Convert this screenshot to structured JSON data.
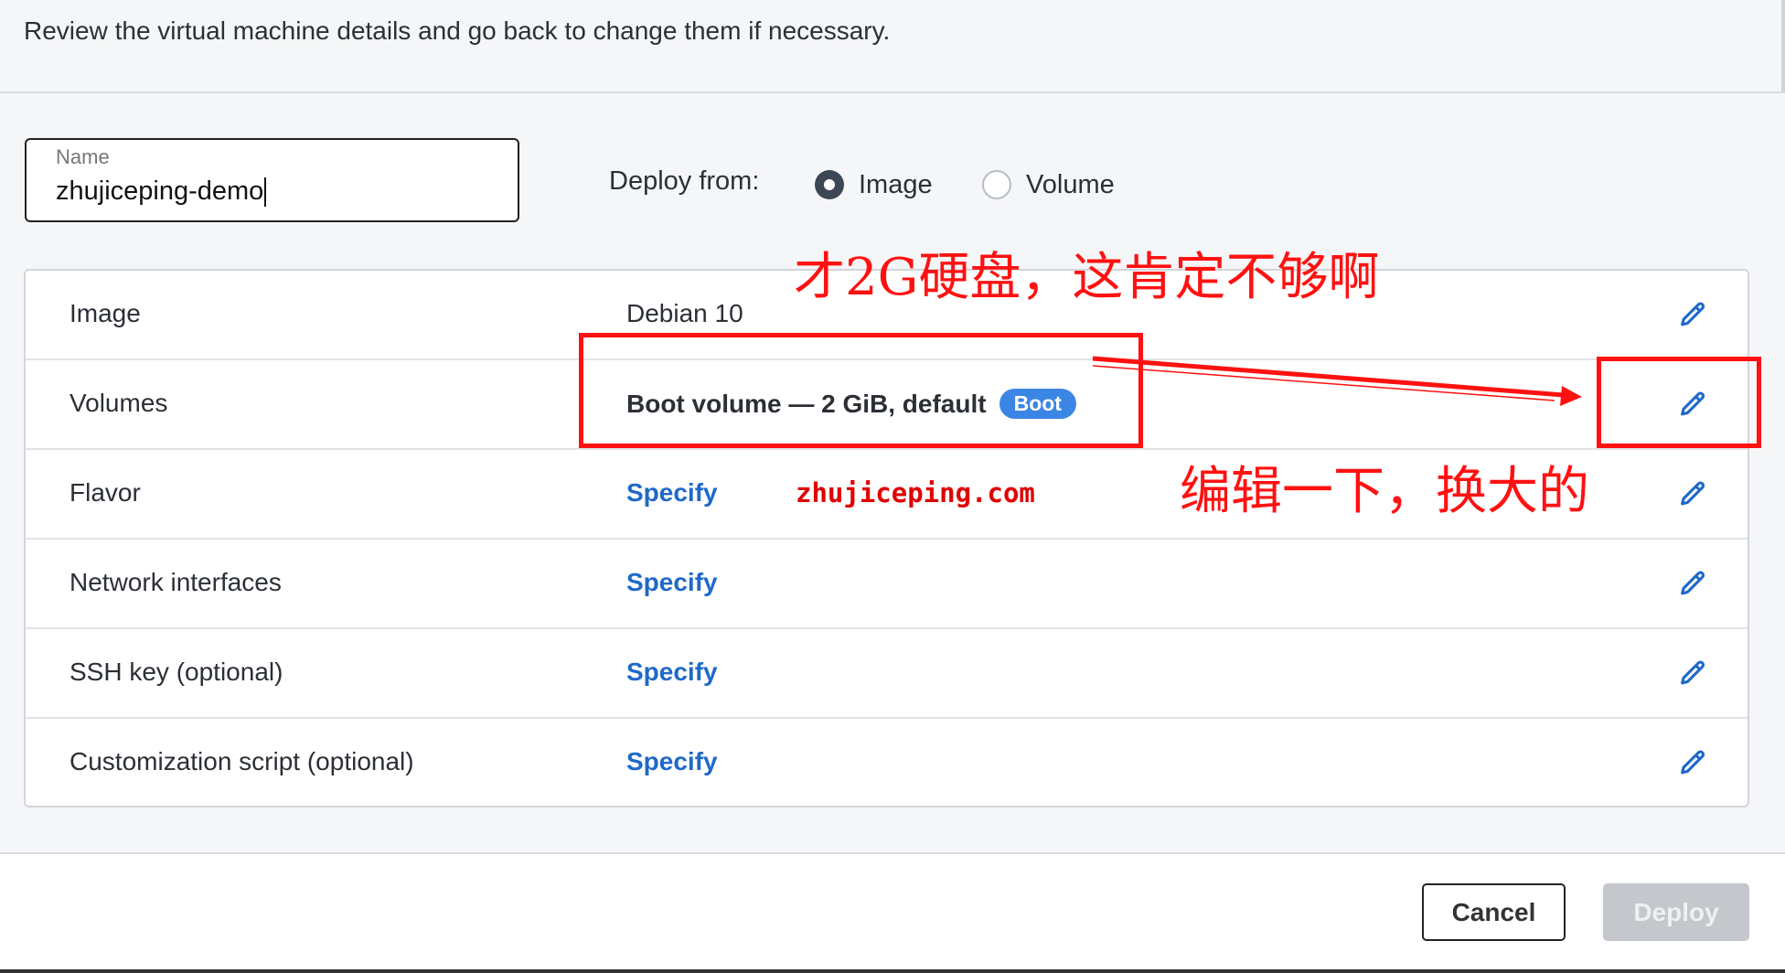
{
  "header": {
    "text": "Review the virtual machine details and go back to change them if necessary."
  },
  "name_field": {
    "label": "Name",
    "value": "zhujiceping-demo"
  },
  "deploy_from": {
    "label": "Deploy from:",
    "options": [
      {
        "label": "Image",
        "selected": true
      },
      {
        "label": "Volume",
        "selected": false
      }
    ]
  },
  "rows": [
    {
      "label": "Image",
      "value": "Debian 10",
      "link": false
    },
    {
      "label": "Volumes",
      "value": "Boot volume  — 2 GiB, default",
      "badge": "Boot",
      "link": false
    },
    {
      "label": "Flavor",
      "value": "Specify",
      "link": true
    },
    {
      "label": "Network interfaces",
      "value": "Specify",
      "link": true
    },
    {
      "label": "SSH key (optional)",
      "value": "Specify",
      "link": true
    },
    {
      "label": "Customization script (optional)",
      "value": "Specify",
      "link": true
    }
  ],
  "footer": {
    "cancel_label": "Cancel",
    "deploy_label": "Deploy"
  },
  "annotations": {
    "top_note": "才2G硬盘，这肯定不够啊",
    "right_note": "编辑一下，换大的",
    "watermark": "zhujiceping.com"
  },
  "colors": {
    "link": "#1f69c8",
    "badge": "#3b86e5",
    "annotation": "#ff1111",
    "deploy_disabled": "#c4c8cd"
  },
  "icons": {
    "edit": "pencil-icon"
  }
}
